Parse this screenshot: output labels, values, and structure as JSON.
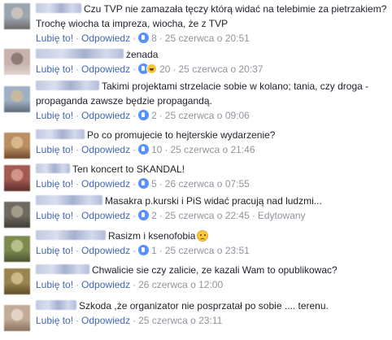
{
  "colors": {
    "link": "#4267b2",
    "meta": "#90949c",
    "text": "#1d2129",
    "like_reaction": "#5890ff",
    "blurred_name": "#b9c4de"
  },
  "labels": {
    "like": "Lubię to!",
    "reply": "Odpowiedz",
    "edited": "Edytowany"
  },
  "comments": [
    {
      "text": "Czu TVP nie zamazała tęczy którą widać na telebimie za pietrzakiem? Trochę wiocha ta impreza, wiocha, że z TVP",
      "reactions": [
        "like"
      ],
      "count": "8",
      "time": "25 czerwca o 20:51",
      "avatar_colors": [
        "#9aa5b0",
        "#c7c2bd",
        "#6d6a66"
      ]
    },
    {
      "text": "żenada",
      "reactions": [
        "like",
        "haha"
      ],
      "count": "20",
      "time": "25 czerwca o 20:37",
      "avatar_colors": [
        "#c7b2ac",
        "#8e7a76",
        "#e1d4d0"
      ]
    },
    {
      "text": "Takimi projektami strzelacie sobie w kolano; tania, czy droga - propaganda zawsze będzie propagandą.",
      "reactions": [
        "like"
      ],
      "count": "2",
      "time": "25 czerwca o 09:06",
      "avatar_colors": [
        "#9fb0c6",
        "#c9b99d",
        "#5f6b78"
      ]
    },
    {
      "text": "Po co promujecie to hejterskie wydarzenie?",
      "reactions": [
        "like"
      ],
      "count": "10",
      "time": "25 czerwca o 21:46",
      "avatar_colors": [
        "#b98e62",
        "#d9b68e",
        "#704a2e"
      ]
    },
    {
      "text": "Ten koncert to SKANDAL!",
      "reactions": [
        "like"
      ],
      "count": "5",
      "time": "26 czerwca o 07:55",
      "avatar_colors": [
        "#a35a52",
        "#d19587",
        "#5a2d2a"
      ]
    },
    {
      "text": "Masakra p.kurski i PiS widać pracują nad ludzmi...",
      "reactions": [
        "like"
      ],
      "count": "2",
      "time": "25 czerwca o 22:45",
      "edited": true,
      "avatar_colors": [
        "#6f6a5f",
        "#a59d8b",
        "#3f3b34"
      ]
    },
    {
      "text": "Rasizm i ksenofobia",
      "emoji": "confused-face",
      "reactions": [
        "like"
      ],
      "count": "1",
      "time": "25 czerwca o 23:51",
      "avatar_colors": [
        "#7c8a4e",
        "#b7bf8d",
        "#4b5330"
      ]
    },
    {
      "text": "Chwalicie sie czy zalicie, ze kazali Wam to opublikowac?",
      "reactions": [],
      "count": "",
      "time": "26 czerwca o 12:00",
      "avatar_colors": [
        "#9a8550",
        "#cbb98a",
        "#5e4e27"
      ]
    },
    {
      "text": "Szkoda ,że organizator nie posprzatał po sobie .... terenu.",
      "reactions": [],
      "count": "",
      "time": "25 czerwca o 23:11",
      "avatar_colors": [
        "#c2ab97",
        "#e3d4c7",
        "#8a7260"
      ]
    }
  ]
}
